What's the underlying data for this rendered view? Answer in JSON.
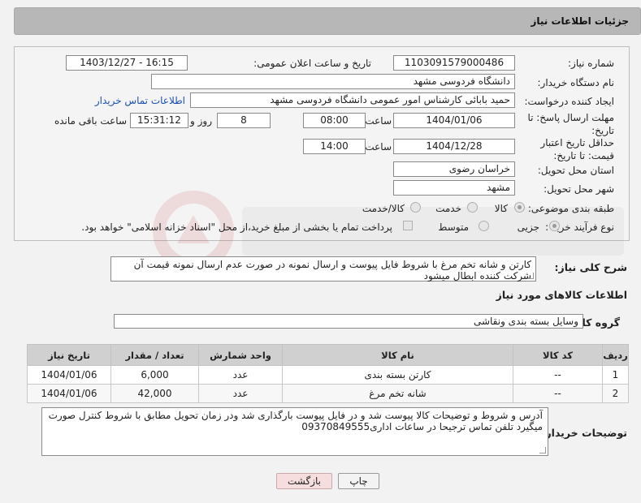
{
  "header": {
    "title": "جزئیات اطلاعات نیاز"
  },
  "form": {
    "need_number_label": "شماره نیاز:",
    "need_number": "1103091579000486",
    "announce_label": "تاریخ و ساعت اعلان عمومی:",
    "announce_value": "1403/12/27 - 16:15",
    "buyer_org_label": "نام دستگاه خریدار:",
    "buyer_org": "دانشگاه فردوسی مشهد",
    "requester_label": "ایجاد کننده درخواست:",
    "requester": "حمید بابائی کارشناس امور عمومی دانشگاه فردوسی مشهد",
    "contact_link": "اطلاعات تماس خریدار",
    "send_deadline_label": "مهلت ارسال پاسخ: تا تاریخ:",
    "send_deadline_date": "1404/01/06",
    "time_label": "ساعت",
    "send_deadline_time": "08:00",
    "days_value": "8",
    "days_label": "روز و",
    "remaining_time": "15:31:12",
    "remaining_label": "ساعت باقی مانده",
    "validity_label": "حداقل تاریخ اعتبار قیمت: تا تاریخ:",
    "validity_date": "1404/12/28",
    "validity_time": "14:00",
    "province_label": "استان محل تحویل:",
    "province": "خراسان رضوی",
    "city_label": "شهر محل تحویل:",
    "city": "مشهد",
    "category_label": "طبقه بندی موضوعی:",
    "category_options": [
      "کالا",
      "خدمت",
      "کالا/خدمت"
    ],
    "process_label": "نوع فرآیند خرید :",
    "process_options": [
      "جزیی",
      "متوسط"
    ],
    "payment_note": "پرداخت تمام یا بخشی از مبلغ خرید،از محل \"اسناد خزانه اسلامی\" خواهد بود."
  },
  "summary": {
    "label": "شرح کلی نیاز:",
    "text": "کارتن و شانه تخم مرغ با شروط فایل پیوست و ارسال نمونه در صورت عدم ارسال نمونه قیمت آن شرکت کننده ابطال میشود"
  },
  "goods": {
    "section_title": "اطلاعات کالاهای مورد نیاز",
    "group_label": "گروه کالا:",
    "group_value": "وسایل بسته بندی  ونقاشی",
    "columns": [
      "ردیف",
      "کد کالا",
      "نام کالا",
      "واحد شمارش",
      "تعداد / مقدار",
      "تاریخ نیاز"
    ],
    "rows": [
      [
        "1",
        "--",
        "کارتن بسته بندی",
        "عدد",
        "6,000",
        "1404/01/06"
      ],
      [
        "2",
        "--",
        "شانه تخم مرغ",
        "عدد",
        "42,000",
        "1404/01/06"
      ]
    ]
  },
  "buyer_notes": {
    "label": "توضیحات خریدار:",
    "text": "آدرس و شروط  و توضیحات کالا پیوست شد و در فایل پیوست بارگذاری شد ودر زمان تحویل مطابق با شروط کنترل صورت میگیرد تلفن تماس  ترجیحا در ساعات اداری09370849555"
  },
  "buttons": {
    "print": "چاپ",
    "back": "بازگشت"
  },
  "colors": {
    "header_bg": "#b7b7b7",
    "link": "#1a4fb3",
    "back_button": "#f7dede"
  }
}
